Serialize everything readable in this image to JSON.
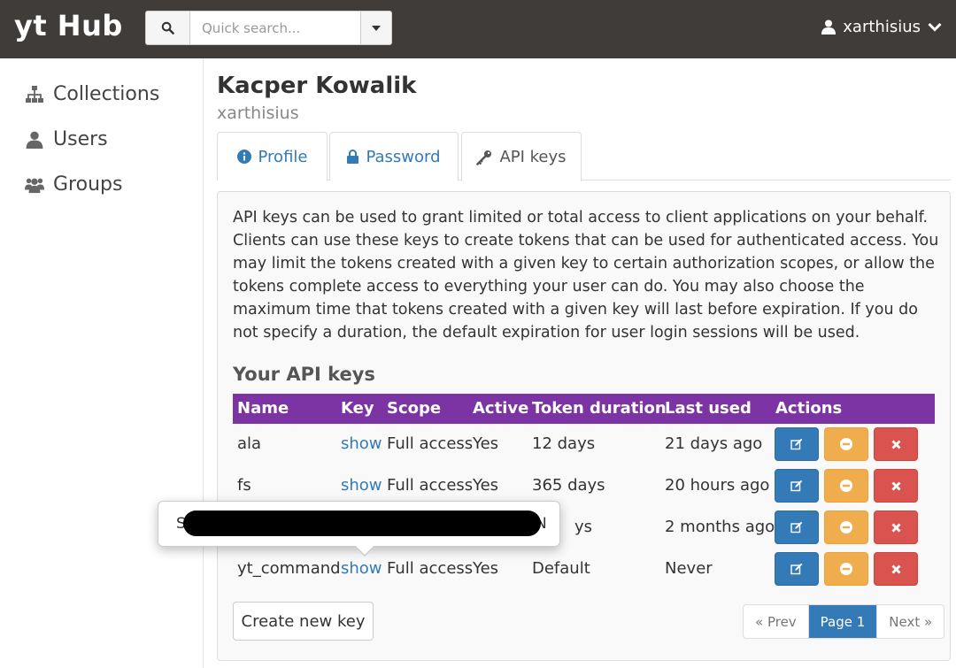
{
  "navbar": {
    "brand": "yt Hub",
    "search_placeholder": "Quick search...",
    "username": "xarthisius",
    "color": "#403c3a"
  },
  "sidebar": {
    "items": [
      {
        "label": "Collections",
        "icon": "sitemap-icon"
      },
      {
        "label": "Users",
        "icon": "user-icon"
      },
      {
        "label": "Groups",
        "icon": "users-icon"
      }
    ]
  },
  "user": {
    "full_name": "Kacper Kowalik",
    "username": "xarthisius"
  },
  "tabs": [
    {
      "label": "Profile",
      "icon": "info-circle-icon"
    },
    {
      "label": "Password",
      "icon": "lock-icon"
    },
    {
      "label": "API keys",
      "icon": "key-icon",
      "active": true
    }
  ],
  "description": "API keys can be used to grant limited or total access to client applications on your behalf. Clients can use these keys to create tokens that can be used for authenticated access. You may limit the tokens created with a given key to certain authorization scopes, or allow the tokens complete access to everything your user can do. You may also choose the maximum time that tokens created with a given key will last before expiration. If you do not specify a duration, the default expiration for user login sessions will be used.",
  "keys_heading": "Your API keys",
  "table": {
    "header_color": "#7c33a3",
    "columns": [
      "Name",
      "Key",
      "Scope",
      "Active",
      "Token duration",
      "Last used",
      "Actions"
    ],
    "rows": [
      {
        "name": "ala",
        "key": "show",
        "scope": "Full access",
        "active": "Yes",
        "duration": "12 days",
        "last_used": "21 days ago"
      },
      {
        "name": "fs",
        "key": "show",
        "scope": "Full access",
        "active": "Yes",
        "duration": "365 days",
        "last_used": "20 hours ago"
      },
      {
        "name": "",
        "key": "",
        "scope": "",
        "active": "",
        "duration": "ys",
        "last_used": "2 months ago"
      },
      {
        "name": "yt_command",
        "key": "show",
        "scope": "Full access",
        "active": "Yes",
        "duration": "Default",
        "last_used": "Never"
      }
    ]
  },
  "popover": {
    "visible_start": "S",
    "visible_end": "N",
    "redacted": true
  },
  "create_button": "Create new key",
  "pagination": {
    "prev": "« Prev",
    "current": "Page 1",
    "next": "Next »"
  }
}
